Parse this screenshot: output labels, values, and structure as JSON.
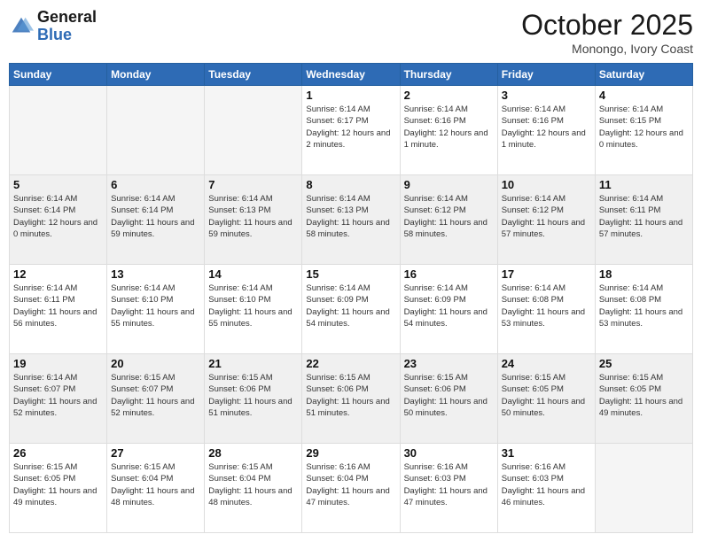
{
  "header": {
    "logo_line1": "General",
    "logo_line2": "Blue",
    "month": "October 2025",
    "location": "Monongo, Ivory Coast"
  },
  "days_of_week": [
    "Sunday",
    "Monday",
    "Tuesday",
    "Wednesday",
    "Thursday",
    "Friday",
    "Saturday"
  ],
  "weeks": [
    [
      {
        "day": "",
        "sunrise": "",
        "sunset": "",
        "daylight": "",
        "empty": true
      },
      {
        "day": "",
        "sunrise": "",
        "sunset": "",
        "daylight": "",
        "empty": true
      },
      {
        "day": "",
        "sunrise": "",
        "sunset": "",
        "daylight": "",
        "empty": true
      },
      {
        "day": "1",
        "sunrise": "Sunrise: 6:14 AM",
        "sunset": "Sunset: 6:17 PM",
        "daylight": "Daylight: 12 hours and 2 minutes."
      },
      {
        "day": "2",
        "sunrise": "Sunrise: 6:14 AM",
        "sunset": "Sunset: 6:16 PM",
        "daylight": "Daylight: 12 hours and 1 minute."
      },
      {
        "day": "3",
        "sunrise": "Sunrise: 6:14 AM",
        "sunset": "Sunset: 6:16 PM",
        "daylight": "Daylight: 12 hours and 1 minute."
      },
      {
        "day": "4",
        "sunrise": "Sunrise: 6:14 AM",
        "sunset": "Sunset: 6:15 PM",
        "daylight": "Daylight: 12 hours and 0 minutes."
      }
    ],
    [
      {
        "day": "5",
        "sunrise": "Sunrise: 6:14 AM",
        "sunset": "Sunset: 6:14 PM",
        "daylight": "Daylight: 12 hours and 0 minutes."
      },
      {
        "day": "6",
        "sunrise": "Sunrise: 6:14 AM",
        "sunset": "Sunset: 6:14 PM",
        "daylight": "Daylight: 11 hours and 59 minutes."
      },
      {
        "day": "7",
        "sunrise": "Sunrise: 6:14 AM",
        "sunset": "Sunset: 6:13 PM",
        "daylight": "Daylight: 11 hours and 59 minutes."
      },
      {
        "day": "8",
        "sunrise": "Sunrise: 6:14 AM",
        "sunset": "Sunset: 6:13 PM",
        "daylight": "Daylight: 11 hours and 58 minutes."
      },
      {
        "day": "9",
        "sunrise": "Sunrise: 6:14 AM",
        "sunset": "Sunset: 6:12 PM",
        "daylight": "Daylight: 11 hours and 58 minutes."
      },
      {
        "day": "10",
        "sunrise": "Sunrise: 6:14 AM",
        "sunset": "Sunset: 6:12 PM",
        "daylight": "Daylight: 11 hours and 57 minutes."
      },
      {
        "day": "11",
        "sunrise": "Sunrise: 6:14 AM",
        "sunset": "Sunset: 6:11 PM",
        "daylight": "Daylight: 11 hours and 57 minutes."
      }
    ],
    [
      {
        "day": "12",
        "sunrise": "Sunrise: 6:14 AM",
        "sunset": "Sunset: 6:11 PM",
        "daylight": "Daylight: 11 hours and 56 minutes."
      },
      {
        "day": "13",
        "sunrise": "Sunrise: 6:14 AM",
        "sunset": "Sunset: 6:10 PM",
        "daylight": "Daylight: 11 hours and 55 minutes."
      },
      {
        "day": "14",
        "sunrise": "Sunrise: 6:14 AM",
        "sunset": "Sunset: 6:10 PM",
        "daylight": "Daylight: 11 hours and 55 minutes."
      },
      {
        "day": "15",
        "sunrise": "Sunrise: 6:14 AM",
        "sunset": "Sunset: 6:09 PM",
        "daylight": "Daylight: 11 hours and 54 minutes."
      },
      {
        "day": "16",
        "sunrise": "Sunrise: 6:14 AM",
        "sunset": "Sunset: 6:09 PM",
        "daylight": "Daylight: 11 hours and 54 minutes."
      },
      {
        "day": "17",
        "sunrise": "Sunrise: 6:14 AM",
        "sunset": "Sunset: 6:08 PM",
        "daylight": "Daylight: 11 hours and 53 minutes."
      },
      {
        "day": "18",
        "sunrise": "Sunrise: 6:14 AM",
        "sunset": "Sunset: 6:08 PM",
        "daylight": "Daylight: 11 hours and 53 minutes."
      }
    ],
    [
      {
        "day": "19",
        "sunrise": "Sunrise: 6:14 AM",
        "sunset": "Sunset: 6:07 PM",
        "daylight": "Daylight: 11 hours and 52 minutes."
      },
      {
        "day": "20",
        "sunrise": "Sunrise: 6:15 AM",
        "sunset": "Sunset: 6:07 PM",
        "daylight": "Daylight: 11 hours and 52 minutes."
      },
      {
        "day": "21",
        "sunrise": "Sunrise: 6:15 AM",
        "sunset": "Sunset: 6:06 PM",
        "daylight": "Daylight: 11 hours and 51 minutes."
      },
      {
        "day": "22",
        "sunrise": "Sunrise: 6:15 AM",
        "sunset": "Sunset: 6:06 PM",
        "daylight": "Daylight: 11 hours and 51 minutes."
      },
      {
        "day": "23",
        "sunrise": "Sunrise: 6:15 AM",
        "sunset": "Sunset: 6:06 PM",
        "daylight": "Daylight: 11 hours and 50 minutes."
      },
      {
        "day": "24",
        "sunrise": "Sunrise: 6:15 AM",
        "sunset": "Sunset: 6:05 PM",
        "daylight": "Daylight: 11 hours and 50 minutes."
      },
      {
        "day": "25",
        "sunrise": "Sunrise: 6:15 AM",
        "sunset": "Sunset: 6:05 PM",
        "daylight": "Daylight: 11 hours and 49 minutes."
      }
    ],
    [
      {
        "day": "26",
        "sunrise": "Sunrise: 6:15 AM",
        "sunset": "Sunset: 6:05 PM",
        "daylight": "Daylight: 11 hours and 49 minutes."
      },
      {
        "day": "27",
        "sunrise": "Sunrise: 6:15 AM",
        "sunset": "Sunset: 6:04 PM",
        "daylight": "Daylight: 11 hours and 48 minutes."
      },
      {
        "day": "28",
        "sunrise": "Sunrise: 6:15 AM",
        "sunset": "Sunset: 6:04 PM",
        "daylight": "Daylight: 11 hours and 48 minutes."
      },
      {
        "day": "29",
        "sunrise": "Sunrise: 6:16 AM",
        "sunset": "Sunset: 6:04 PM",
        "daylight": "Daylight: 11 hours and 47 minutes."
      },
      {
        "day": "30",
        "sunrise": "Sunrise: 6:16 AM",
        "sunset": "Sunset: 6:03 PM",
        "daylight": "Daylight: 11 hours and 47 minutes."
      },
      {
        "day": "31",
        "sunrise": "Sunrise: 6:16 AM",
        "sunset": "Sunset: 6:03 PM",
        "daylight": "Daylight: 11 hours and 46 minutes."
      },
      {
        "day": "",
        "sunrise": "",
        "sunset": "",
        "daylight": "",
        "empty": true
      }
    ]
  ]
}
